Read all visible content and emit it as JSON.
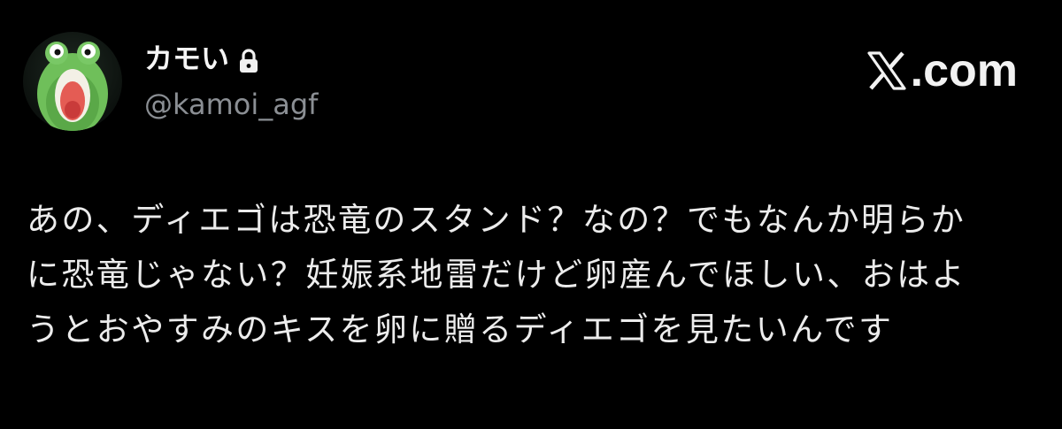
{
  "author": {
    "display_name": "カモい",
    "handle": "@kamoi_agf",
    "avatar_icon": "frog-avatar-icon",
    "protected_icon": "lock-icon"
  },
  "brand": {
    "icon": "x-logo-icon",
    "text": ".com"
  },
  "tweet": {
    "text": "あの、ディエゴは恐竜のスタンド？なの？でもなんか明らか\nに恐竜じゃない？妊娠系地雷だけど卵産んでほしい、おはよ\nうとおやすみのキスを卵に贈るディエゴを見たいんです"
  },
  "colors": {
    "background": "#000000",
    "text": "#ececec",
    "handle": "#8b8f94"
  }
}
